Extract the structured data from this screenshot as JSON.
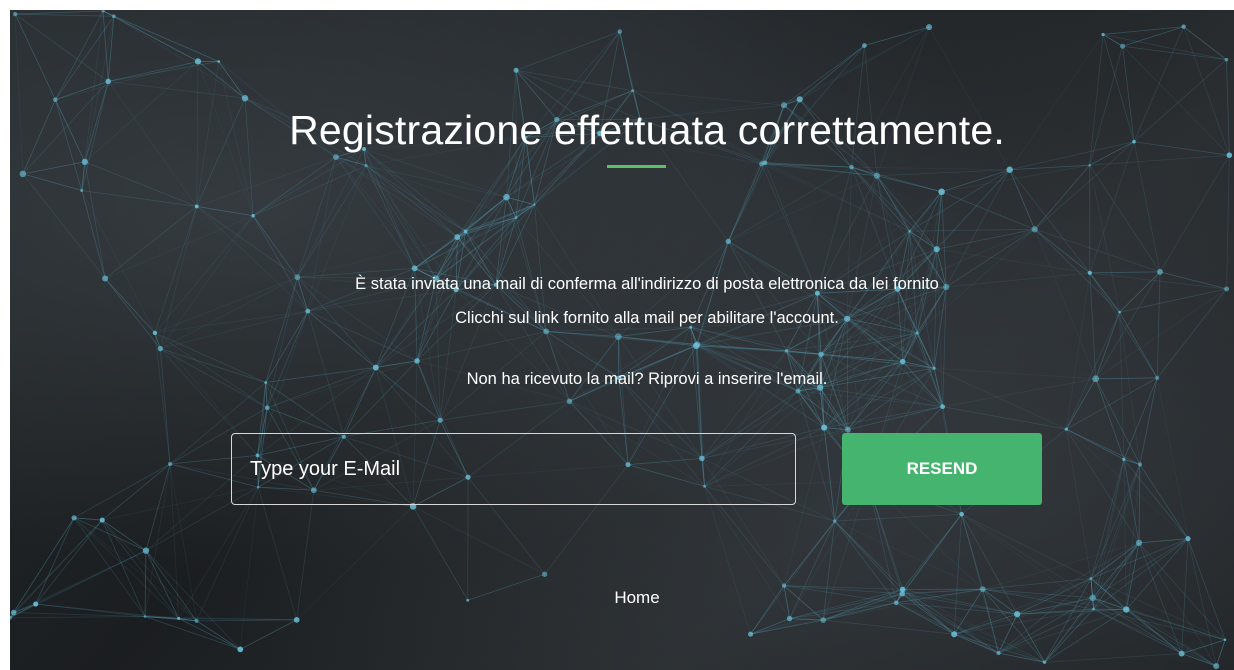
{
  "page": {
    "title": "Registrazione effettuata correttamente.",
    "message_line1": "È stata inviata una mail di conferma all'indirizzo di posta elettronica da lei fornito",
    "message_line2": "Clicchi sul link fornito alla mail per abilitare l'account.",
    "retry_prompt": "Non ha ricevuto la mail? Riprovi a inserire l'email."
  },
  "form": {
    "email_placeholder": "Type your E-Mail",
    "email_value": "",
    "resend_label": "RESEND"
  },
  "footer": {
    "home_label": "Home"
  },
  "colors": {
    "accent_underline": "#5cc06a",
    "button_green": "#45b46e",
    "network_line": "#5aa8c0",
    "network_node": "#6cc4dc"
  }
}
